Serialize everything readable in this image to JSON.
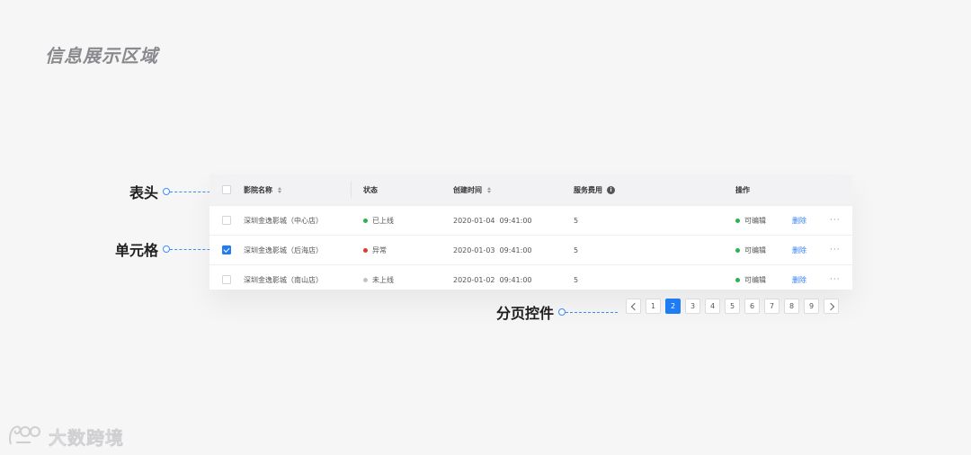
{
  "page": {
    "title": "信息展示区域"
  },
  "annotations": {
    "header": "表头",
    "cell": "单元格",
    "pagination": "分页控件"
  },
  "table": {
    "columns": {
      "name": "影院名称",
      "status": "状态",
      "created_time": "创建时间",
      "service_fee": "服务费用",
      "actions": "操作"
    },
    "rows": [
      {
        "checked": false,
        "name": "深圳金逸影城（中心店）",
        "status": "已上线",
        "status_color": "#2bb350",
        "created_time": "2020-01-04  09:41:00",
        "fee": "5",
        "edit_state": "可编辑",
        "edit_color": "#2bb350",
        "delete": "删除",
        "more": "···"
      },
      {
        "checked": true,
        "name": "深圳金逸影城（后海店）",
        "status": "异常",
        "status_color": "#e03a30",
        "created_time": "2020-01-03  09:41:00",
        "fee": "5",
        "edit_state": "可编辑",
        "edit_color": "#2bb350",
        "delete": "删除",
        "more": "···"
      },
      {
        "checked": false,
        "name": "深圳金逸影城（南山店）",
        "status": "未上线",
        "status_color": "#c2c2c6",
        "created_time": "2020-01-02  09:41:00",
        "fee": "5",
        "edit_state": "可编辑",
        "edit_color": "#2bb350",
        "delete": "删除",
        "more": "···"
      }
    ]
  },
  "pagination": {
    "pages": [
      "1",
      "2",
      "3",
      "4",
      "5",
      "6",
      "7",
      "8",
      "9"
    ],
    "current": "2"
  },
  "watermark": {
    "text": "大数跨境"
  },
  "colors": {
    "accent": "#1f7cf5",
    "annotation": "#3c8cff"
  }
}
